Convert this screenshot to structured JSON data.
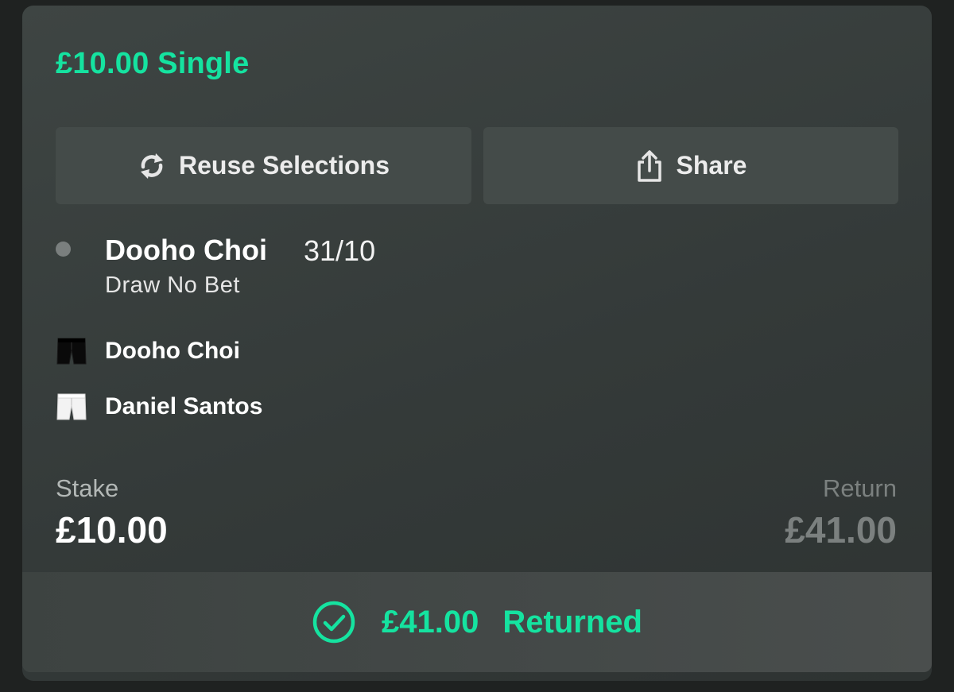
{
  "bet": {
    "title": "£10.00 Single",
    "accent_color": "#15e3a0"
  },
  "actions": {
    "reuse_label": "Reuse Selections",
    "reuse_icon": "refresh-icon",
    "share_label": "Share",
    "share_icon": "share-icon"
  },
  "selection": {
    "name": "Dooho Choi",
    "odds": "31/10",
    "market": "Draw No Bet"
  },
  "competitors": [
    {
      "name": "Dooho Choi",
      "icon": "black-shorts-icon"
    },
    {
      "name": "Daniel Santos",
      "icon": "white-shorts-icon"
    }
  ],
  "stake": {
    "label": "Stake",
    "value": "£10.00"
  },
  "return": {
    "label": "Return",
    "value": "£41.00"
  },
  "status": {
    "amount": "£41.00",
    "text": "Returned",
    "icon": "check-circle-icon"
  }
}
